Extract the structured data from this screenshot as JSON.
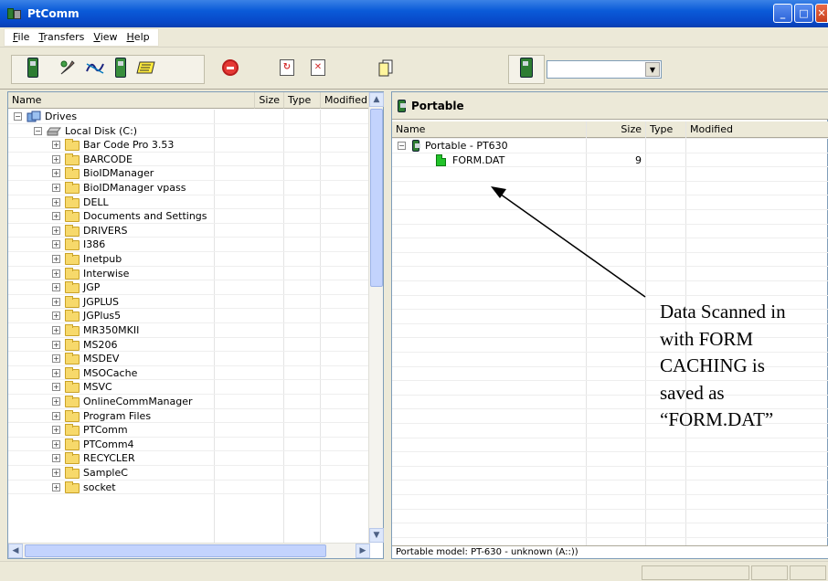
{
  "window": {
    "title": "PtComm"
  },
  "menu": [
    {
      "ul": "F",
      "rest": "ile"
    },
    {
      "ul": "T",
      "rest": "ransfers"
    },
    {
      "ul": "V",
      "rest": "iew"
    },
    {
      "ul": "H",
      "rest": "elp"
    }
  ],
  "left_pane": {
    "columns": [
      "Name",
      "Size",
      "Type",
      "Modified"
    ],
    "root": "Drives",
    "disk": "Local Disk (C:)",
    "folders": [
      "Bar Code Pro 3.53",
      "BARCODE",
      "BioIDManager",
      "BioIDManager vpass",
      "DELL",
      "Documents and Settings",
      "DRIVERS",
      "I386",
      "Inetpub",
      "Interwise",
      "JGP",
      "JGPLUS",
      "JGPlus5",
      "MR350MKII",
      "MS206",
      "MSDEV",
      "MSOCache",
      "MSVC",
      "OnlineCommManager",
      "Program Files",
      "PTComm",
      "PTComm4",
      "RECYCLER",
      "SampleC",
      "socket"
    ]
  },
  "right_pane": {
    "title": "Portable",
    "columns": [
      "Name",
      "Size",
      "Type",
      "Modified"
    ],
    "device": "Portable - PT630",
    "file": {
      "name": "FORM.DAT",
      "size": "9"
    },
    "status": "Portable model: PT-630 - unknown (A::))"
  },
  "annotation": {
    "lines": [
      "Data Scanned in",
      "with FORM",
      "CACHING is",
      "saved as",
      "“FORM.DAT”"
    ]
  },
  "colors": {
    "title_bar": "#0a5ad8",
    "folder": "#f7d96b",
    "device": "#2e7d32",
    "file": "#22c32a"
  }
}
